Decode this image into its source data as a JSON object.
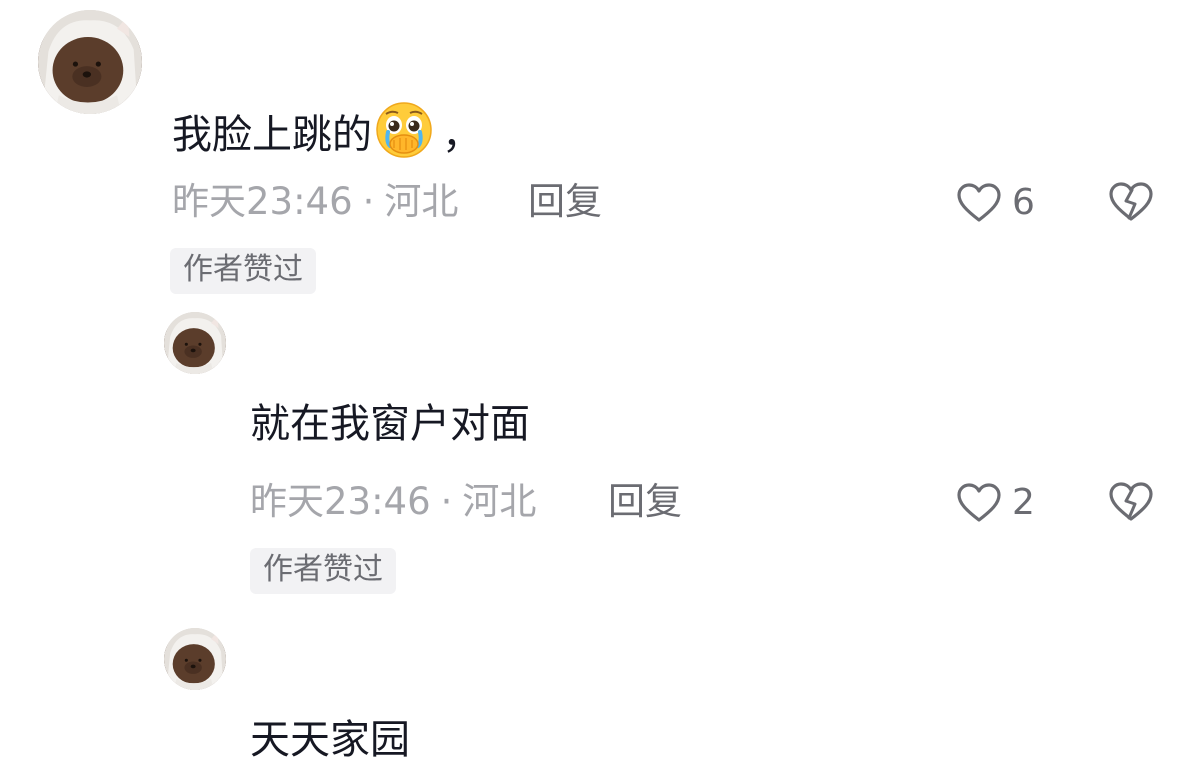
{
  "comments": [
    {
      "text": "我脸上跳的",
      "emoji": "crying-face-emoji",
      "suffix": "，",
      "time": "昨天23:46",
      "separator": "·",
      "location": "河北",
      "reply_label": "回复",
      "likes": "6",
      "badge": "作者赞过"
    },
    {
      "text": "就在我窗户对面",
      "time": "昨天23:46",
      "separator": "·",
      "location": "河北",
      "reply_label": "回复",
      "likes": "2",
      "badge": "作者赞过"
    },
    {
      "text": "天天家园"
    }
  ],
  "icons": {
    "like": "heart-outline-icon",
    "dislike": "broken-heart-icon"
  },
  "colors": {
    "primary_text": "#161823",
    "meta_text": "#a5a6ab",
    "secondary_text": "#6b6c72",
    "badge_bg": "#f2f2f4"
  }
}
